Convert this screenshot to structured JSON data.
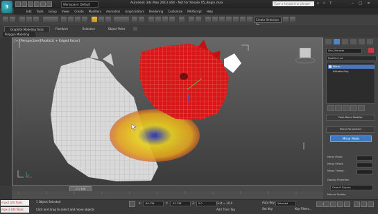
{
  "titlebar": {
    "logo": "3",
    "workspace": "Workspace: Default",
    "app_title": "Autodesk 3ds Max 2013 x64 - Not for Resale   05_Begin.max",
    "search_placeholder": "Type a keyword or phrase"
  },
  "menu": [
    "Edit",
    "Tools",
    "Group",
    "Views",
    "Create",
    "Modifiers",
    "Animation",
    "Graph Editors",
    "Rendering",
    "Customize",
    "MAXScript",
    "Help"
  ],
  "toolbar": {
    "create_selection": "Create Selection Se"
  },
  "ribbon": {
    "tabs": [
      "Graphite Modeling Tools",
      "Freeform",
      "Selection",
      "Object Paint"
    ],
    "polygon_modeling": "Polygon Modeling"
  },
  "viewport": {
    "label": "[+][Perspective][Realistic + Edged Faces]"
  },
  "command_panel": {
    "object_name": "Skin_Monster",
    "modifier_list": "Modifier List",
    "stack": [
      "Mirror",
      "Editable Poly"
    ],
    "rollouts": {
      "paint_deform": "Paint Blend Modifier",
      "mirror_params": "Mirror Parameters"
    },
    "mirror_button": "Mirror Mode",
    "params": [
      {
        "label": "Mirror Plane:",
        "value": ""
      },
      {
        "label": "Mirror Offset:",
        "value": ""
      },
      {
        "label": "Mirror Thresh:",
        "value": ""
      }
    ],
    "display_projection": "Display Projection",
    "default_option": "Default Display",
    "manual_update": "Manual Update"
  },
  "timeline": {
    "frame": "17 / 100"
  },
  "status": {
    "mxs1": "max2.Util:Tools",
    "mxs2": "max 2 Util:Tools",
    "line1": "1 Object Selected",
    "line2": "Click and drag to select and move objects",
    "x_label": "X:",
    "x_value": "-69.336",
    "y_label": "Y:",
    "y_value": "-35.238",
    "z_label": "Z:",
    "z_value": "0.0",
    "grid": "Grid = 10.0",
    "add_time_tag": "Add Time Tag",
    "auto_key": "Auto Key",
    "set_key": "Set Key",
    "selected": "Selected",
    "key_filters": "Key Filters..."
  }
}
